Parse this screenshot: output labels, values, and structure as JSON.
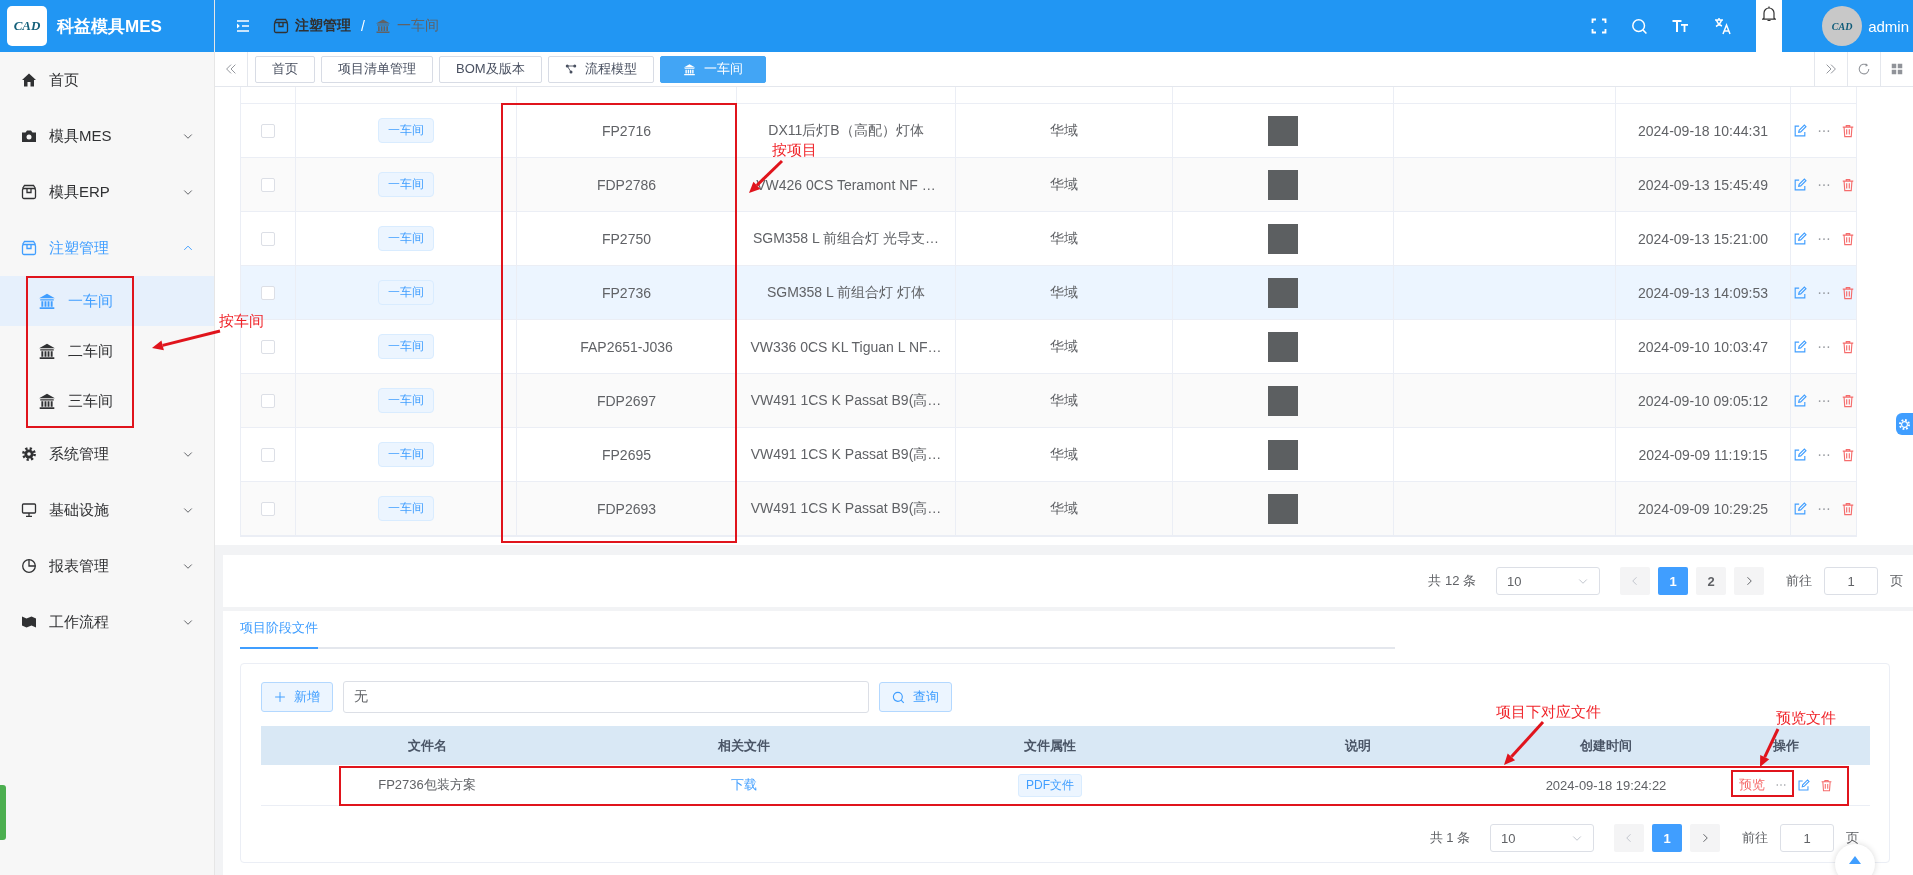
{
  "app": {
    "logo_text": "CAD",
    "title": "科益模具MES"
  },
  "header": {
    "breadcrumb": [
      "注塑管理",
      "一车间"
    ],
    "breadcrumb_separator": "/",
    "user": {
      "avatar_text": "CAD",
      "name": "admin"
    }
  },
  "sidebar": {
    "items": [
      {
        "label": "首页",
        "kind": "link"
      },
      {
        "label": "模具MES",
        "kind": "submenu",
        "expanded": false,
        "active": false
      },
      {
        "label": "模具ERP",
        "kind": "submenu",
        "expanded": false,
        "active": false
      },
      {
        "label": "注塑管理",
        "kind": "submenu",
        "expanded": true,
        "active": true,
        "children": [
          {
            "label": "一车间",
            "selected": true
          },
          {
            "label": "二车间",
            "selected": false
          },
          {
            "label": "三车间",
            "selected": false
          }
        ]
      },
      {
        "label": "系统管理",
        "kind": "submenu",
        "expanded": false,
        "active": false
      },
      {
        "label": "基础设施",
        "kind": "submenu",
        "expanded": false,
        "active": false
      },
      {
        "label": "报表管理",
        "kind": "submenu",
        "expanded": false,
        "active": false
      },
      {
        "label": "工作流程",
        "kind": "submenu",
        "expanded": false,
        "active": false
      }
    ]
  },
  "tabs": [
    {
      "label": "首页",
      "selected": false
    },
    {
      "label": "项目清单管理",
      "selected": false
    },
    {
      "label": "BOM及版本",
      "selected": false
    },
    {
      "label": "流程模型",
      "selected": false
    },
    {
      "label": "一车间",
      "selected": true
    }
  ],
  "table": {
    "rows": [
      {
        "selected": false,
        "checked": false,
        "workshop": "一车间",
        "code": "FP2716",
        "name": "DX11后灯B（高配）灯体",
        "customer": "华域",
        "created": "2024-09-18 10:44:31"
      },
      {
        "selected": false,
        "checked": false,
        "workshop": "一车间",
        "code": "FDP2786",
        "name": "VW426 0CS Teramont NF …",
        "customer": "华域",
        "created": "2024-09-13 15:45:49"
      },
      {
        "selected": false,
        "checked": false,
        "workshop": "一车间",
        "code": "FP2750",
        "name": "SGM358 L 前组合灯 光导支…",
        "customer": "华域",
        "created": "2024-09-13 15:21:00"
      },
      {
        "selected": true,
        "checked": false,
        "workshop": "一车间",
        "code": "FP2736",
        "name": "SGM358 L 前组合灯 灯体",
        "customer": "华域",
        "created": "2024-09-13 14:09:53"
      },
      {
        "selected": false,
        "checked": false,
        "workshop": "一车间",
        "code": "FAP2651-J036",
        "name": "VW336 0CS KL Tiguan L NF…",
        "customer": "华域",
        "created": "2024-09-10 10:03:47"
      },
      {
        "selected": false,
        "checked": false,
        "workshop": "一车间",
        "code": "FDP2697",
        "name": "VW491 1CS K Passat B9(高…",
        "customer": "华域",
        "created": "2024-09-10 09:05:12"
      },
      {
        "selected": false,
        "checked": false,
        "workshop": "一车间",
        "code": "FP2695",
        "name": "VW491 1CS K Passat B9(高…",
        "customer": "华域",
        "created": "2024-09-09 11:19:15"
      },
      {
        "selected": false,
        "checked": false,
        "workshop": "一车间",
        "code": "FDP2693",
        "name": "VW491 1CS K Passat B9(高…",
        "customer": "华域",
        "created": "2024-09-09 10:29:25"
      }
    ]
  },
  "pagination": {
    "total": "共 12 条",
    "page_size": "10",
    "pages": [
      {
        "label": "1",
        "selected": true
      },
      {
        "label": "2",
        "selected": false
      }
    ],
    "goto_label": "前往",
    "goto_value": "1",
    "page_unit": "页"
  },
  "files_panel": {
    "tabs": [
      {
        "label": "项目阶段文件",
        "selected": true
      }
    ],
    "add_button": "新增",
    "search_value": "无",
    "query_button": "查询",
    "columns": [
      "文件名",
      "相关文件",
      "文件属性",
      "说明",
      "创建时间",
      "操作"
    ],
    "rows": [
      {
        "name": "FP2736包装方案",
        "file_link": "下载",
        "type_tag": "PDF文件",
        "created": "2024-09-18 19:24:22",
        "preview": "预览"
      }
    ],
    "pagination": {
      "total": "共 1 条",
      "page_size": "10",
      "pages": [
        {
          "label": "1",
          "selected": true
        }
      ],
      "goto_label": "前往",
      "goto_value": "1",
      "page_unit": "页"
    }
  },
  "annotations": [
    {
      "label": "按车间"
    },
    {
      "label": "按项目"
    },
    {
      "label": "项目下对应文件"
    },
    {
      "label": "预览文件"
    }
  ]
}
